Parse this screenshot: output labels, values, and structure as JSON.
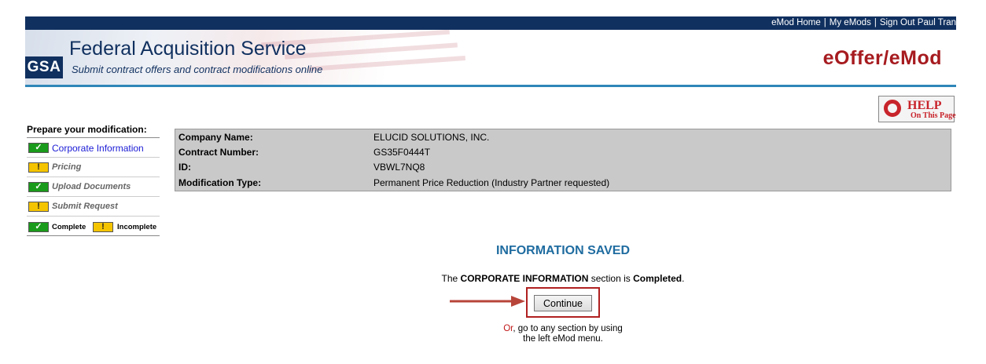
{
  "top_links": [
    "eMod Home",
    "My eMods",
    "Sign Out Paul Tran"
  ],
  "header": {
    "logo": "GSA",
    "title": "Federal Acquisition Service",
    "subtitle": "Submit contract offers and contract modifications online",
    "app_name": "eOffer/eMod"
  },
  "help": {
    "title": "HELP",
    "sub": "On This Page"
  },
  "menu": {
    "title": "Prepare your modification:",
    "items": [
      {
        "label": "Corporate Information",
        "status": "complete"
      },
      {
        "label": "Pricing",
        "status": "incomplete"
      },
      {
        "label": "Upload Documents",
        "status": "complete"
      },
      {
        "label": "Submit Request",
        "status": "incomplete"
      }
    ],
    "legend_complete": "Complete",
    "legend_incomplete": "Incomplete",
    "check_glyph": "✓",
    "warn_glyph": "!"
  },
  "info": {
    "rows": [
      {
        "key": "Company Name:",
        "value": "ELUCID SOLUTIONS, INC."
      },
      {
        "key": "Contract Number:",
        "value": "GS35F0444T"
      },
      {
        "key": "ID:",
        "value": "VBWL7NQ8"
      },
      {
        "key": "Modification Type:",
        "value": "Permanent Price Reduction (Industry Partner requested)"
      }
    ]
  },
  "confirmation": {
    "title": "INFORMATION SAVED",
    "msg_pre": "The ",
    "msg_section": "CORPORATE INFORMATION",
    "msg_mid": " section is ",
    "msg_status": "Completed",
    "msg_end": ".",
    "continue_label": "Continue",
    "or_word": "Or",
    "or_rest": ", go to any section by using",
    "or_line2": "the left eMod menu."
  },
  "colors": {
    "navy": "#10305f",
    "accent_red": "#a61b1f",
    "rule_blue": "#2f86b8",
    "saved_blue": "#1f6ca0"
  }
}
